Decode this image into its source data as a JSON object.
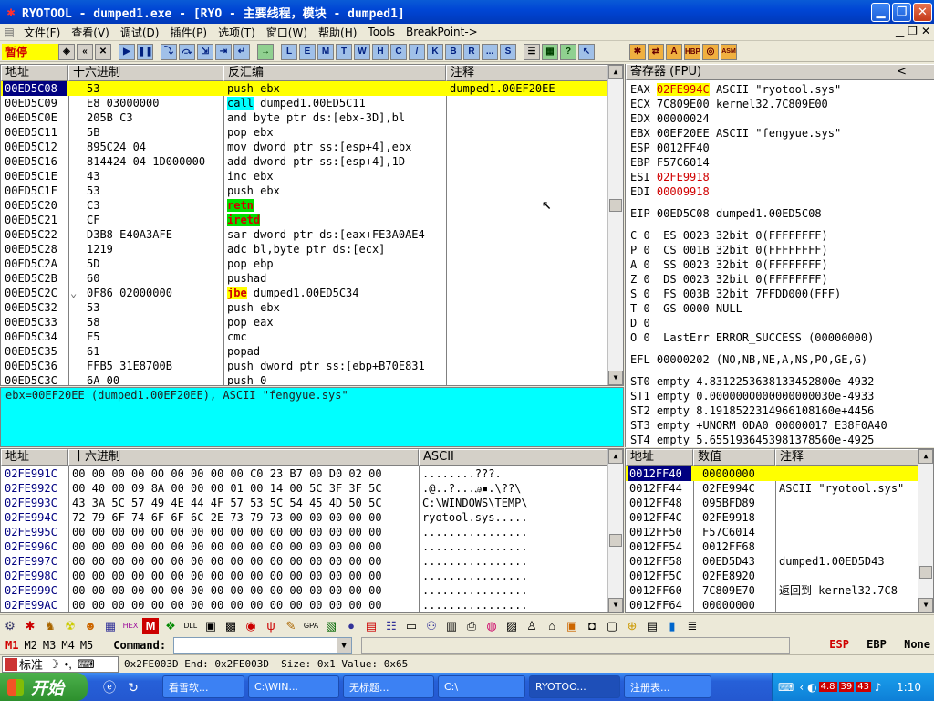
{
  "window": {
    "title": "RYOTOOL - dumped1.exe - [RYO - 主要线程，模块 - dumped1]"
  },
  "menu": [
    "文件(F)",
    "查看(V)",
    "调试(D)",
    "插件(P)",
    "选项(T)",
    "窗口(W)",
    "帮助(H)",
    "Tools",
    "BreakPoint->"
  ],
  "toolbar": {
    "status": "暂停",
    "letters": [
      "L",
      "E",
      "M",
      "T",
      "W",
      "H",
      "C",
      "/",
      "K",
      "B",
      "R",
      "...",
      "S"
    ]
  },
  "disasm": {
    "headers": {
      "addr": "地址",
      "hex": "十六进制",
      "code": "反汇编",
      "comment": "注释"
    },
    "rows": [
      {
        "addr": "00ED5C08",
        "hex": "53",
        "code": "push ebx",
        "comment": "dumped1.00EF20EE",
        "selected": true
      },
      {
        "addr": "00ED5C09",
        "hex": "E8 03000000",
        "mnem": "call",
        "ops": " dumped1.00ED5C11",
        "hl": "cyan"
      },
      {
        "addr": "00ED5C0E",
        "hex": "205B C3",
        "code": "and byte ptr ds:[ebx-3D],bl"
      },
      {
        "addr": "00ED5C11",
        "hex": "5B",
        "code": "pop ebx"
      },
      {
        "addr": "00ED5C12",
        "hex": "895C24 04",
        "code": "mov dword ptr ss:[esp+4],ebx"
      },
      {
        "addr": "00ED5C16",
        "hex": "814424 04 1D000000",
        "code": "add dword ptr ss:[esp+4],1D"
      },
      {
        "addr": "00ED5C1E",
        "hex": "43",
        "code": "inc ebx"
      },
      {
        "addr": "00ED5C1F",
        "hex": "53",
        "code": "push ebx"
      },
      {
        "addr": "00ED5C20",
        "hex": "C3",
        "mnem": "retn",
        "ops": "",
        "hl": "green"
      },
      {
        "addr": "00ED5C21",
        "hex": "CF",
        "mnem": "iretd",
        "ops": "",
        "hl": "green"
      },
      {
        "addr": "00ED5C22",
        "hex": "D3B8 E40A3AFE",
        "code": "sar dword ptr ds:[eax+FE3A0AE4"
      },
      {
        "addr": "00ED5C28",
        "hex": "1219",
        "code": "adc bl,byte ptr ds:[ecx]"
      },
      {
        "addr": "00ED5C2A",
        "hex": "5D",
        "code": "pop ebp"
      },
      {
        "addr": "00ED5C2B",
        "hex": "60",
        "code": "pushad"
      },
      {
        "addr": "00ED5C2C",
        "hex": "0F86 02000000",
        "mnem": "jbe",
        "ops": " dumped1.00ED5C34",
        "hl": "yellow",
        "jump": "⌄"
      },
      {
        "addr": "00ED5C32",
        "hex": "53",
        "code": "push ebx"
      },
      {
        "addr": "00ED5C33",
        "hex": "58",
        "code": "pop eax"
      },
      {
        "addr": "00ED5C34",
        "hex": "F5",
        "code": "cmc"
      },
      {
        "addr": "00ED5C35",
        "hex": "61",
        "code": "popad"
      },
      {
        "addr": "00ED5C36",
        "hex": "FFB5 31E8700B",
        "code": "push dword ptr ss:[ebp+B70E831"
      },
      {
        "addr": "00ED5C3C",
        "hex": "6A 00",
        "code": "push 0"
      }
    ]
  },
  "info": {
    "text": "ebx=00EF20EE (dumped1.00EF20EE), ASCII \"fengyue.sys\""
  },
  "registers": {
    "header": "寄存器 (FPU)",
    "collapse": "<",
    "lines": [
      {
        "name": "EAX",
        "val": "02FE994C",
        "note": "ASCII \"ryotool.sys\"",
        "style": "hi"
      },
      {
        "name": "ECX",
        "val": "7C809E00",
        "note": "kernel32.7C809E00"
      },
      {
        "name": "EDX",
        "val": "00000024",
        "note": ""
      },
      {
        "name": "EBX",
        "val": "00EF20EE",
        "note": "ASCII \"fengyue.sys\""
      },
      {
        "name": "ESP",
        "val": "0012FF40",
        "note": ""
      },
      {
        "name": "EBP",
        "val": "F57C6014",
        "note": ""
      },
      {
        "name": "ESI",
        "val": "02FE9918",
        "note": "",
        "style": "chg"
      },
      {
        "name": "EDI",
        "val": "00009918",
        "note": "",
        "style": "chg"
      },
      {
        "gap": true
      },
      {
        "name": "EIP",
        "val": "00ED5C08",
        "note": "dumped1.00ED5C08"
      },
      {
        "gap": true
      },
      {
        "text": "C 0  ES 0023 32bit 0(FFFFFFFF)"
      },
      {
        "text": "P 0  CS 001B 32bit 0(FFFFFFFF)"
      },
      {
        "text": "A 0  SS 0023 32bit 0(FFFFFFFF)"
      },
      {
        "text": "Z 0  DS 0023 32bit 0(FFFFFFFF)"
      },
      {
        "text": "S 0  FS 003B 32bit 7FFDD000(FFF)"
      },
      {
        "text": "T 0  GS 0000 NULL"
      },
      {
        "text": "D 0"
      },
      {
        "text": "O 0  LastErr ERROR_SUCCESS (00000000)"
      },
      {
        "gap": true
      },
      {
        "text": "EFL 00000202 (NO,NB,NE,A,NS,PO,GE,G)"
      },
      {
        "gap": true
      },
      {
        "text": "ST0 empty 4.8312253638133452800e-4932"
      },
      {
        "text": "ST1 empty 0.0000000000000000030e-4933"
      },
      {
        "text": "ST2 empty 8.1918522314966108160e+4456"
      },
      {
        "text": "ST3 empty +UNORM 0DA0 00000017 E38F0A40"
      },
      {
        "text": "ST4 empty 5.6551936453981378560e-4925"
      }
    ]
  },
  "dump": {
    "headers": {
      "addr": "地址",
      "hex": "十六进制",
      "ascii": "ASCII"
    },
    "rows": [
      {
        "addr": "02FE991C",
        "hex": "00 00 00 00 00 00 00 00 00 C0 23 B7 00 D0 02 00",
        "ascii": "........???."
      },
      {
        "addr": "02FE992C",
        "hex": "00 40 00 09 8A 00 00 00 01 00 14 00 5C 3F 3F 5C",
        "ascii": ".@..?...ꭿ▪.\\??\\"
      },
      {
        "addr": "02FE993C",
        "hex": "43 3A 5C 57 49 4E 44 4F 57 53 5C 54 45 4D 50 5C",
        "ascii": "C:\\WINDOWS\\TEMP\\"
      },
      {
        "addr": "02FE994C",
        "hex": "72 79 6F 74 6F 6F 6C 2E 73 79 73 00 00 00 00 00",
        "ascii": "ryotool.sys....."
      },
      {
        "addr": "02FE995C",
        "hex": "00 00 00 00 00 00 00 00 00 00 00 00 00 00 00 00",
        "ascii": "................"
      },
      {
        "addr": "02FE996C",
        "hex": "00 00 00 00 00 00 00 00 00 00 00 00 00 00 00 00",
        "ascii": "................"
      },
      {
        "addr": "02FE997C",
        "hex": "00 00 00 00 00 00 00 00 00 00 00 00 00 00 00 00",
        "ascii": "................"
      },
      {
        "addr": "02FE998C",
        "hex": "00 00 00 00 00 00 00 00 00 00 00 00 00 00 00 00",
        "ascii": "................"
      },
      {
        "addr": "02FE999C",
        "hex": "00 00 00 00 00 00 00 00 00 00 00 00 00 00 00 00",
        "ascii": "................"
      },
      {
        "addr": "02FE99AC",
        "hex": "00 00 00 00 00 00 00 00 00 00 00 00 00 00 00 00",
        "ascii": "................"
      }
    ]
  },
  "stack": {
    "headers": {
      "addr": "地址",
      "val": "数值",
      "comment": "注释"
    },
    "rows": [
      {
        "addr": "0012FF40",
        "val": "00000000",
        "comment": "",
        "selected": true
      },
      {
        "addr": "0012FF44",
        "val": "02FE994C",
        "comment": "ASCII \"ryotool.sys\""
      },
      {
        "addr": "0012FF48",
        "val": "095BFD89",
        "comment": ""
      },
      {
        "addr": "0012FF4C",
        "val": "02FE9918",
        "comment": ""
      },
      {
        "addr": "0012FF50",
        "val": "F57C6014",
        "comment": ""
      },
      {
        "addr": "0012FF54",
        "val": "0012FF68",
        "comment": ""
      },
      {
        "addr": "0012FF58",
        "val": "00ED5D43",
        "comment": "dumped1.00ED5D43"
      },
      {
        "addr": "0012FF5C",
        "val": "02FE8920",
        "comment": ""
      },
      {
        "addr": "0012FF60",
        "val": "7C809E70",
        "comment": "返回到 kernel32.7C8"
      },
      {
        "addr": "0012FF64",
        "val": "00000000",
        "comment": ""
      }
    ]
  },
  "command": {
    "marks": [
      "M1",
      "M2",
      "M3",
      "M4",
      "M5"
    ],
    "label": "Command:",
    "value": "",
    "regs": [
      "ESP",
      "EBP",
      "None"
    ]
  },
  "status": {
    "ime": "标准",
    "text": "0x2FE003D End: 0x2FE003D  Size: 0x1 Value: 0x65"
  },
  "taskbar": {
    "start": "开始",
    "tasks": [
      "看雪软...",
      "C:\\WIN...",
      "无标题...",
      "C:\\",
      "RYOTOO...",
      "注册表..."
    ],
    "tray_badges": [
      "4.8",
      "39",
      "43"
    ],
    "clock": "1:10"
  }
}
